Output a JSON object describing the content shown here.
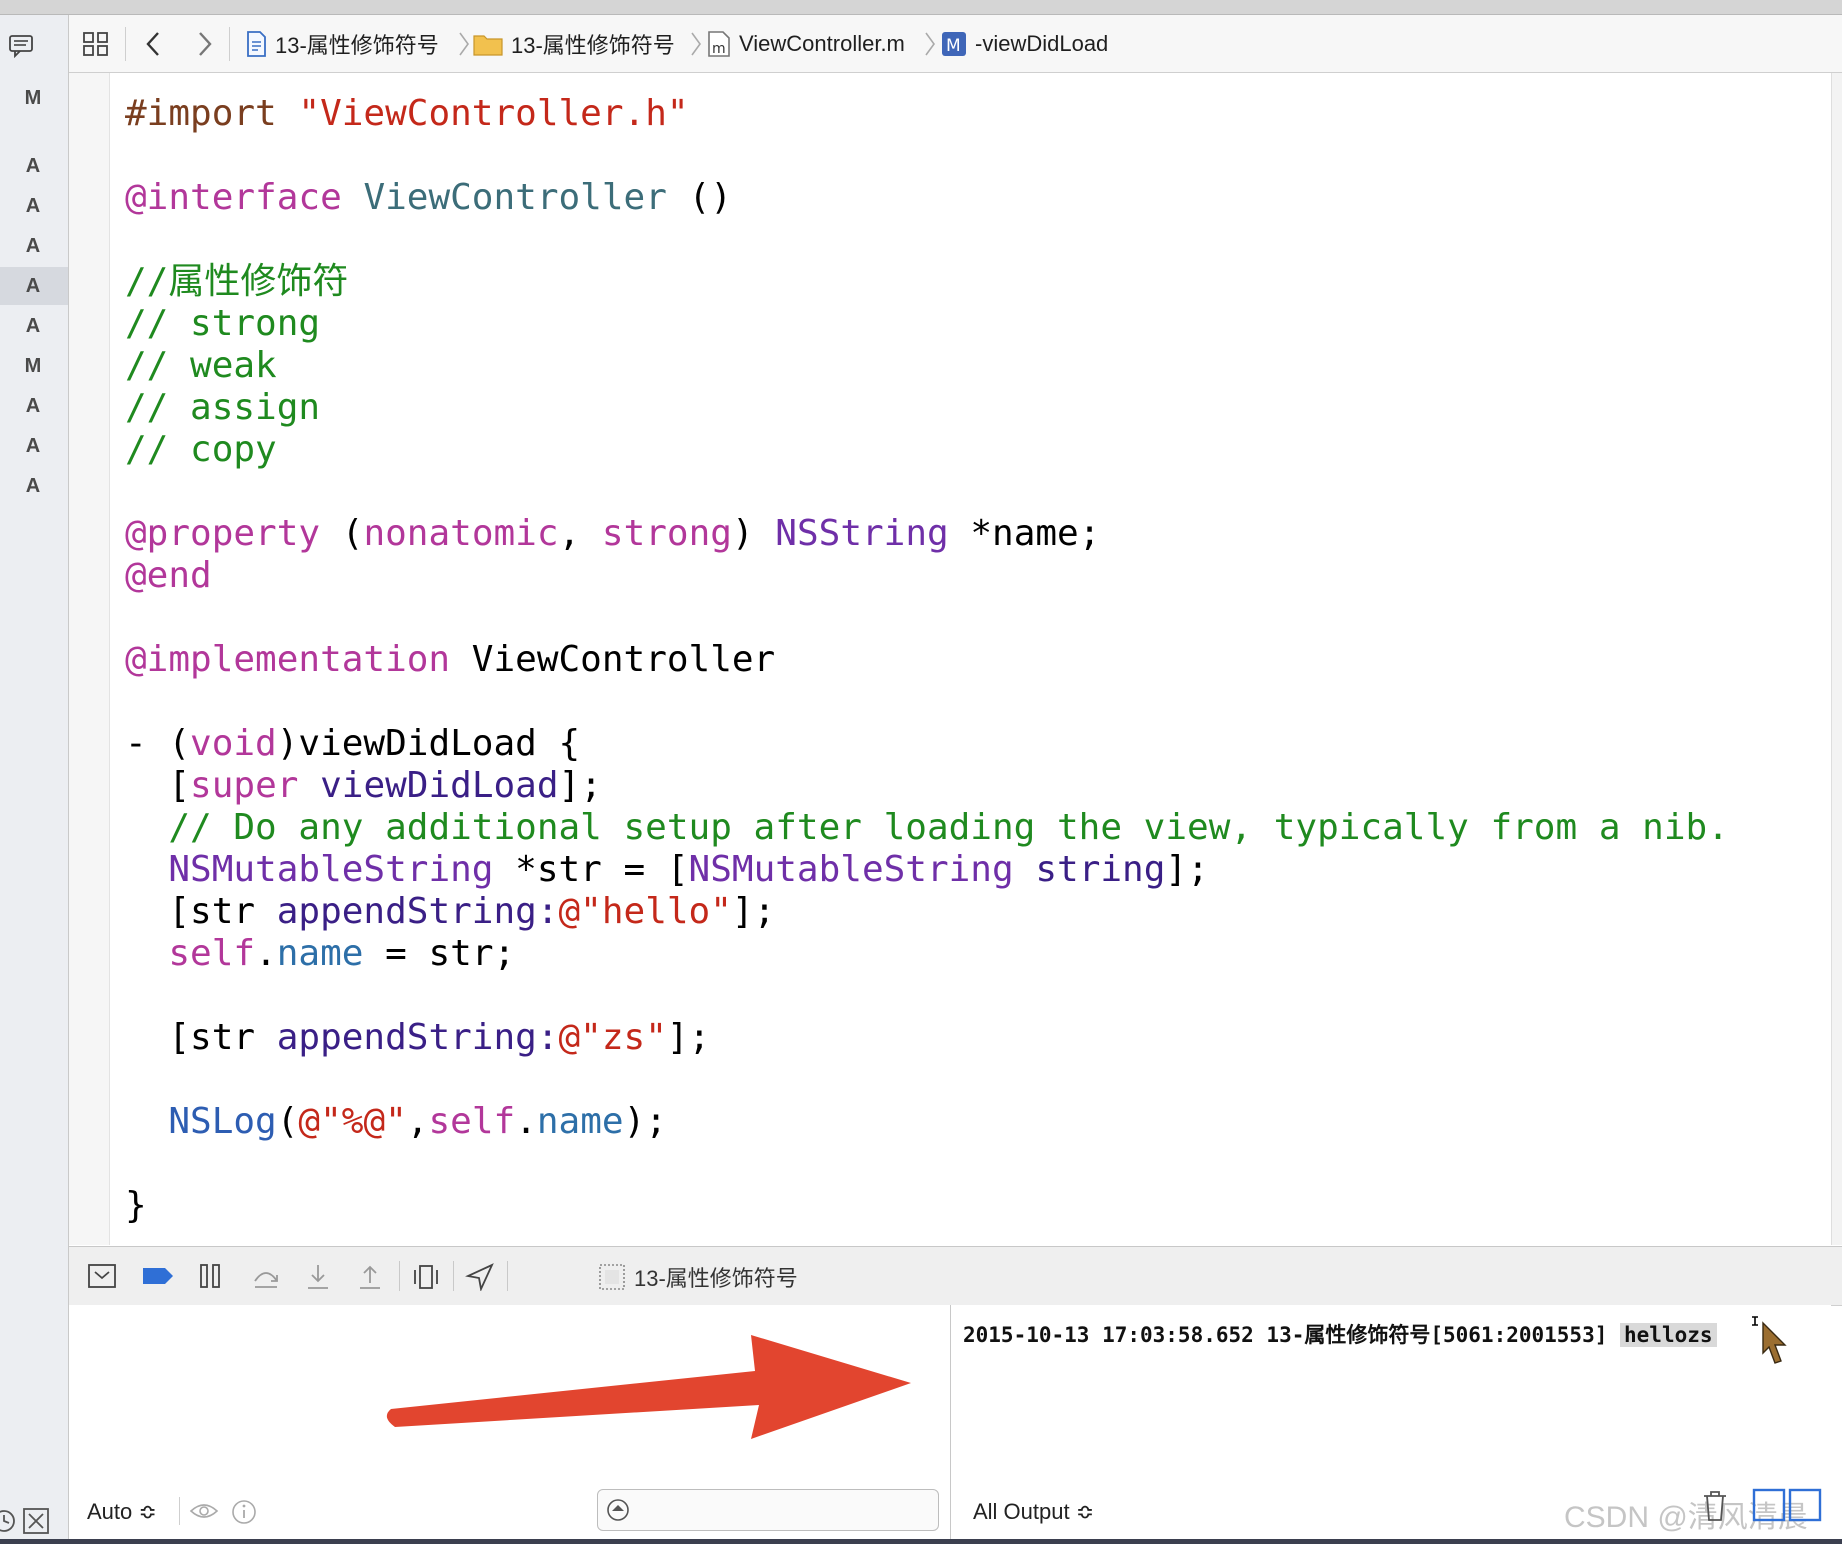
{
  "gutter": {
    "statuses": [
      "M",
      "A",
      "A",
      "A",
      "A",
      "A",
      "M",
      "A",
      "A",
      "A"
    ],
    "active_index": 4
  },
  "jump_bar": {
    "crumbs": [
      {
        "label": "13-属性修饰符号",
        "kind": "project-icon"
      },
      {
        "label": "13-属性修饰符号",
        "kind": "folder-icon"
      },
      {
        "label": "ViewController.m",
        "kind": "m-file-icon"
      },
      {
        "label": "-viewDidLoad",
        "kind": "method-icon"
      }
    ]
  },
  "code": {
    "l1_import": "#import",
    "l1_file": "\"ViewController.h\"",
    "l3_interface": "@interface",
    "l3_class": "ViewController",
    "l3_rest": "()",
    "l5_comment": "//属性修饰符",
    "l6_comment": "// strong",
    "l7_comment": "// weak",
    "l8_comment": "// assign",
    "l9_comment": "// copy",
    "l11_property": "@property",
    "l11_open": "(",
    "l11_nonatomic": "nonatomic",
    "l11_comma": ", ",
    "l11_strong": "strong",
    "l11_close": ") ",
    "l11_type": "NSString",
    "l11_rest": " *name;",
    "l12_end": "@end",
    "l14_impl": "@implementation",
    "l14_class": "ViewController",
    "l16_start": "- (",
    "l16_void": "void",
    "l16_rest": ")viewDidLoad {",
    "l17_open": "[",
    "l17_super": "super",
    "l17_method": "viewDidLoad",
    "l17_rest": "];",
    "l18_comment": "// Do any additional setup after loading the view, typically from a nib.",
    "l19_type": "NSMutableString",
    "l19_mid": " *str = [",
    "l19_type2": "NSMutableString",
    "l19_method": "string",
    "l19_rest": "];",
    "l20_open": "[str ",
    "l20_method": "appendString:",
    "l20_str": "@\"hello\"",
    "l20_rest": "];",
    "l21_self": "self",
    "l21_dot": ".",
    "l21_prop": "name",
    "l21_rest": " = str;",
    "l23_open": "[str ",
    "l23_method": "appendString:",
    "l23_str": "@\"zs\"",
    "l23_rest": "];",
    "l25_fn": "NSLog",
    "l25_open": "(",
    "l25_str": "@\"%@\"",
    "l25_comma": ",",
    "l25_self": "self",
    "l25_dot": ".",
    "l25_prop": "name",
    "l25_rest": ");",
    "l27_close": "}"
  },
  "debug_bar": {
    "target": "13-属性修饰符号"
  },
  "variables": {
    "scope": "Auto ≎"
  },
  "console": {
    "log_prefix": "2015-10-13 17:03:58.652 13-属性修饰符号[5061:2001553] ",
    "log_value": "hellozs",
    "output_filter": "All Output ≎",
    "watermark": "CSDN @清风清晨"
  },
  "colors": {
    "keyword": "#b2379a",
    "string": "#c4281a",
    "comment": "#1f8a1f",
    "arrow": "#e2452f",
    "debug_active": "#2f6fd6"
  }
}
